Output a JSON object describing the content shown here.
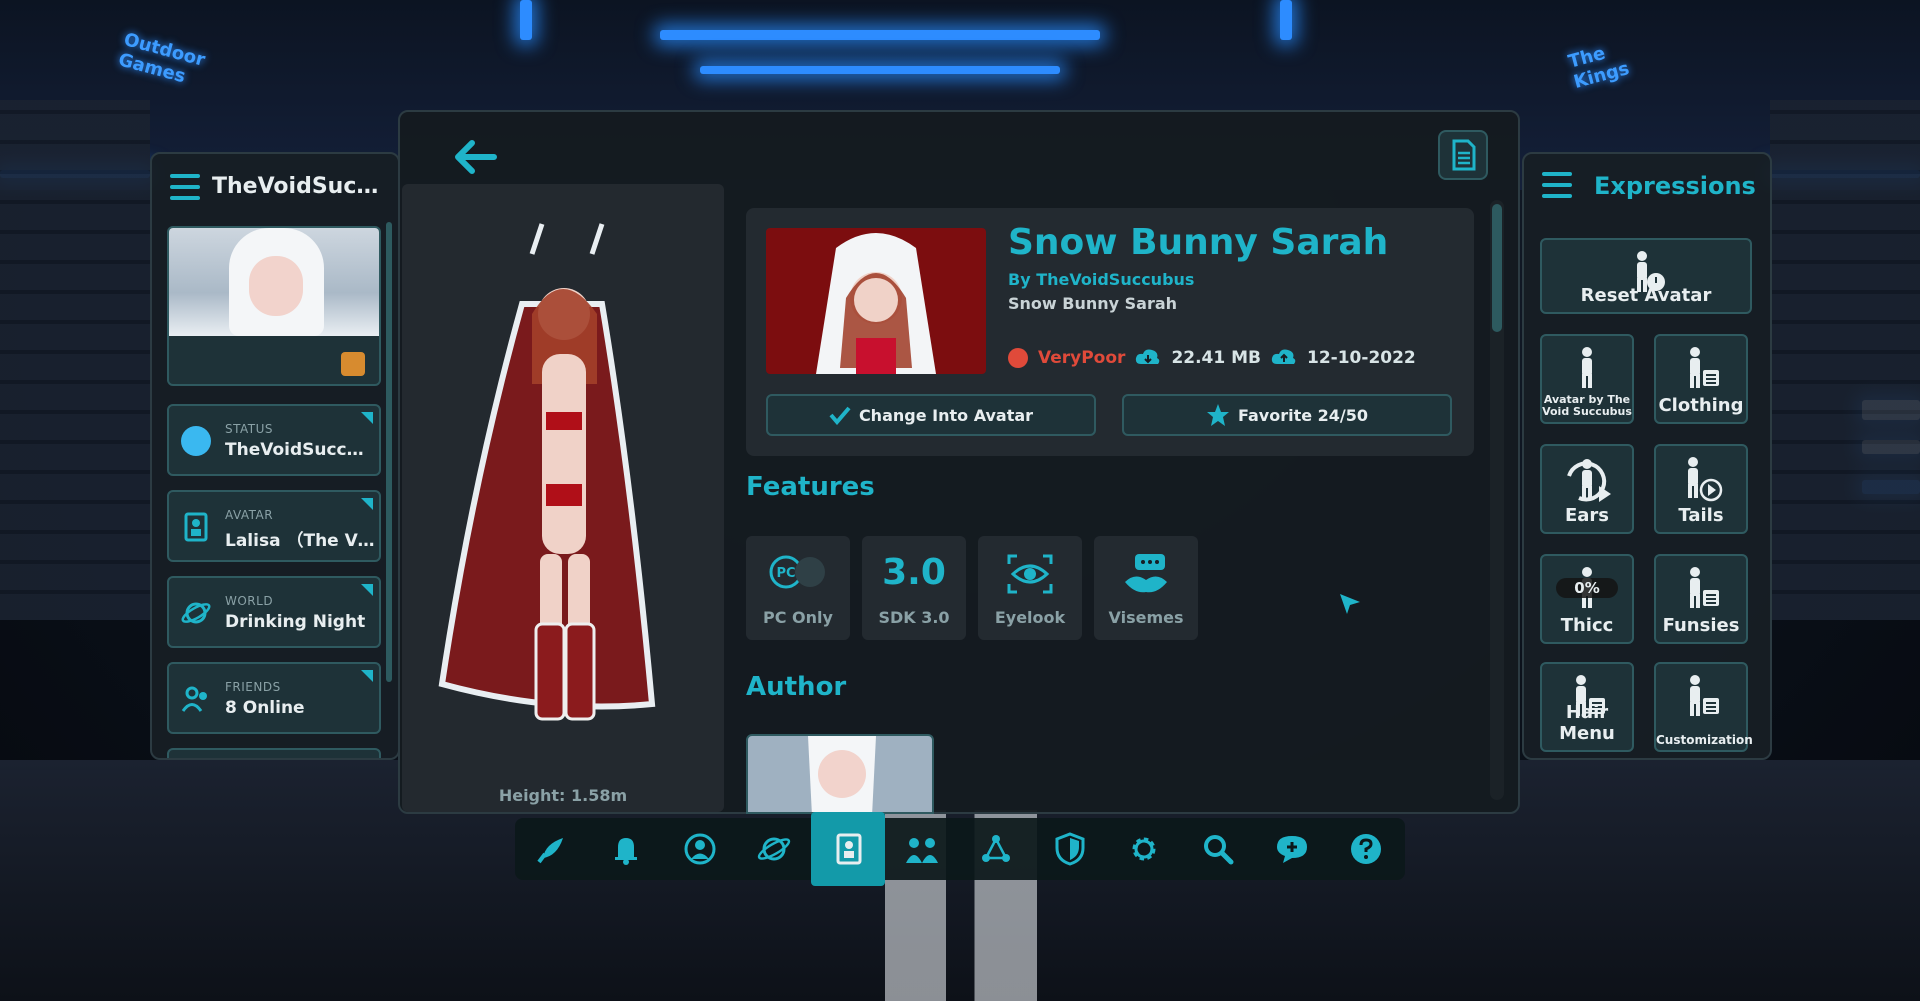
{
  "left_panel": {
    "title": "TheVoidSucc...",
    "cards": [
      {
        "caption": "STATUS",
        "value": "TheVoidSuccu..."
      },
      {
        "caption": "AVATAR",
        "value": "Lalisa （The Vi..."
      },
      {
        "caption": "WORLD",
        "value": "Drinking Night"
      },
      {
        "caption": "FRIENDS",
        "value": "8 Online"
      }
    ]
  },
  "avatar": {
    "name": "Snow Bunny Sarah",
    "author": "By TheVoidSuccubus",
    "description": "Snow Bunny Sarah",
    "performance": "VeryPoor",
    "size": "22.41 MB",
    "date": "12-10-2022",
    "height": "Height: 1.58m",
    "change_button": "Change Into Avatar",
    "favorite_button": "Favorite 24/50"
  },
  "sections": {
    "features": "Features",
    "author": "Author"
  },
  "features": [
    {
      "icon": "PC",
      "label": "PC Only"
    },
    {
      "icon": "3.0",
      "label": "SDK 3.0"
    },
    {
      "icon": "eye-icon",
      "label": "Eyelook"
    },
    {
      "icon": "lips-icon",
      "label": "Visemes"
    }
  ],
  "right_panel": {
    "title": "Expressions",
    "reset": "Reset Avatar",
    "buttons": [
      {
        "label": "Avatar by The Void Succubus"
      },
      {
        "label": "Clothing"
      },
      {
        "label": "Ears"
      },
      {
        "label": "Tails"
      },
      {
        "label": "Thicc",
        "badge": "0%"
      },
      {
        "label": "Funsies"
      },
      {
        "label": "Hair Menu"
      },
      {
        "label": "Customization"
      }
    ]
  },
  "dock": [
    "rocket-icon",
    "bell-icon",
    "profile-icon",
    "world-icon",
    "avatar-icon",
    "social-icon",
    "groups-icon",
    "safety-icon",
    "settings-icon",
    "search-icon",
    "chat-icon",
    "help-icon"
  ],
  "bg_signs": {
    "left": "Outdoor Games",
    "right": "The Kings"
  },
  "colors": {
    "accent": "#1fb4c9",
    "warning": "#e04a3a",
    "panel": "#171e24"
  }
}
